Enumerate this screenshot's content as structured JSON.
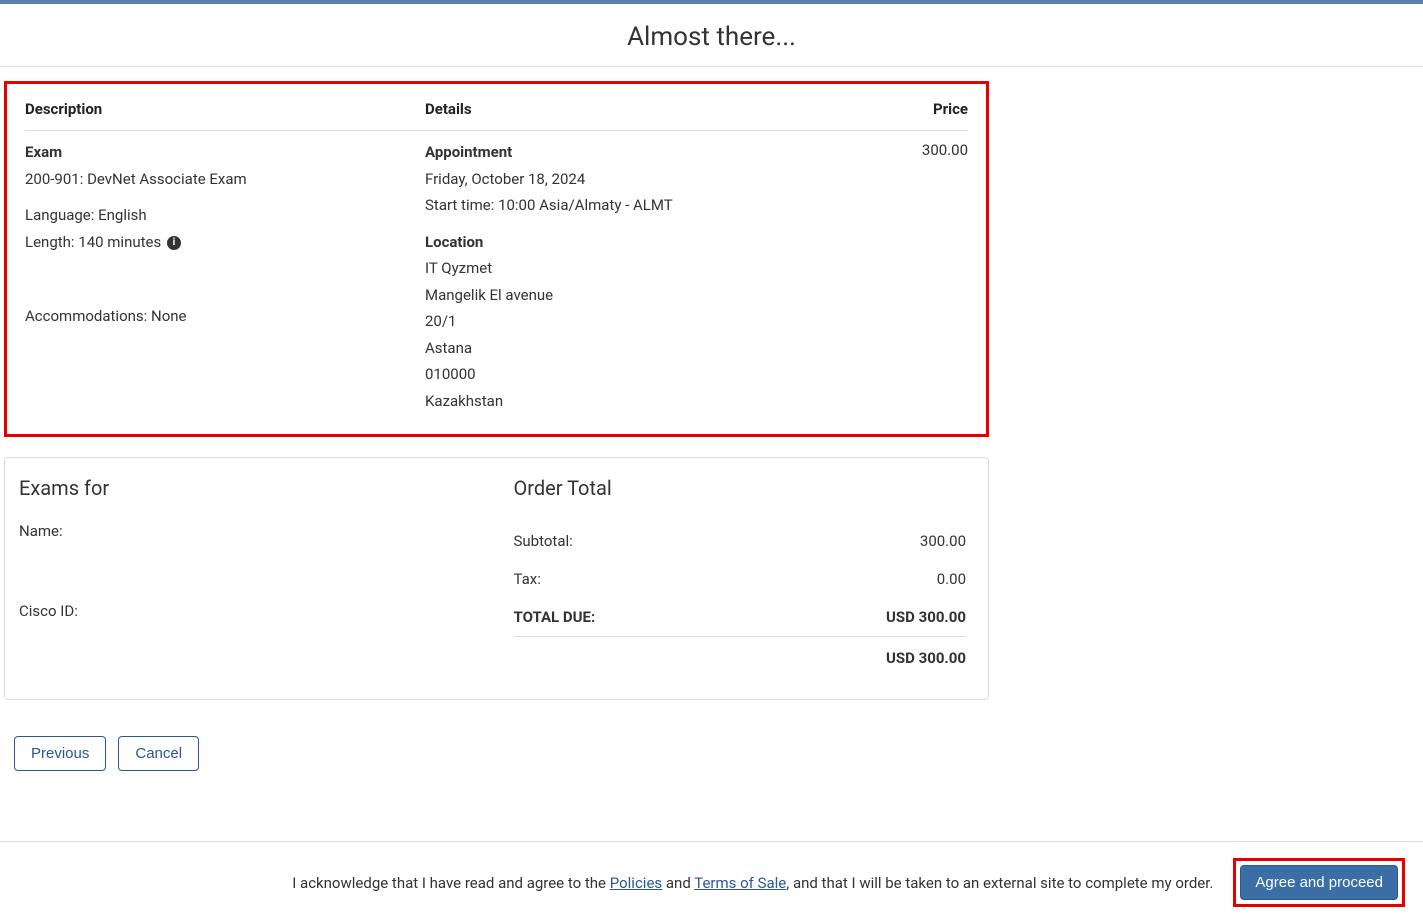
{
  "page_title": "Almost there...",
  "table": {
    "headers": {
      "description": "Description",
      "details": "Details",
      "price": "Price"
    },
    "description": {
      "exam_label": "Exam",
      "exam_name": "200-901: DevNet Associate Exam",
      "language": "Language: English",
      "length": "Length: 140 minutes",
      "accommodations": "Accommodations: None"
    },
    "details": {
      "appointment_label": "Appointment",
      "date": "Friday, October 18, 2024",
      "start_time": "Start time: 10:00 Asia/Almaty - ALMT",
      "location_label": "Location",
      "loc_name": "IT Qyzmet",
      "loc_street": "Mangelik El avenue",
      "loc_num": "20/1",
      "loc_city": "Astana",
      "loc_zip": "010000",
      "loc_country": "Kazakhstan"
    },
    "price": "300.00"
  },
  "exams_for": {
    "heading": "Exams for",
    "name_label": "Name:",
    "name_value": "",
    "cisco_id_label": "Cisco ID:",
    "cisco_id_value": ""
  },
  "order_total": {
    "heading": "Order Total",
    "subtotal_label": "Subtotal:",
    "subtotal_value": "300.00",
    "tax_label": "Tax:",
    "tax_value": "0.00",
    "total_due_label": "TOTAL DUE:",
    "total_due_value": "USD 300.00",
    "grand_total": "USD 300.00"
  },
  "buttons": {
    "previous": "Previous",
    "cancel": "Cancel",
    "agree": "Agree and proceed"
  },
  "footer": {
    "pre": "I acknowledge that I have read and agree to the ",
    "policies": "Policies",
    "and": " and ",
    "terms": "Terms of Sale",
    "post": ", and that I will be taken to an external site to complete my order."
  },
  "icons": {
    "info": "i"
  }
}
